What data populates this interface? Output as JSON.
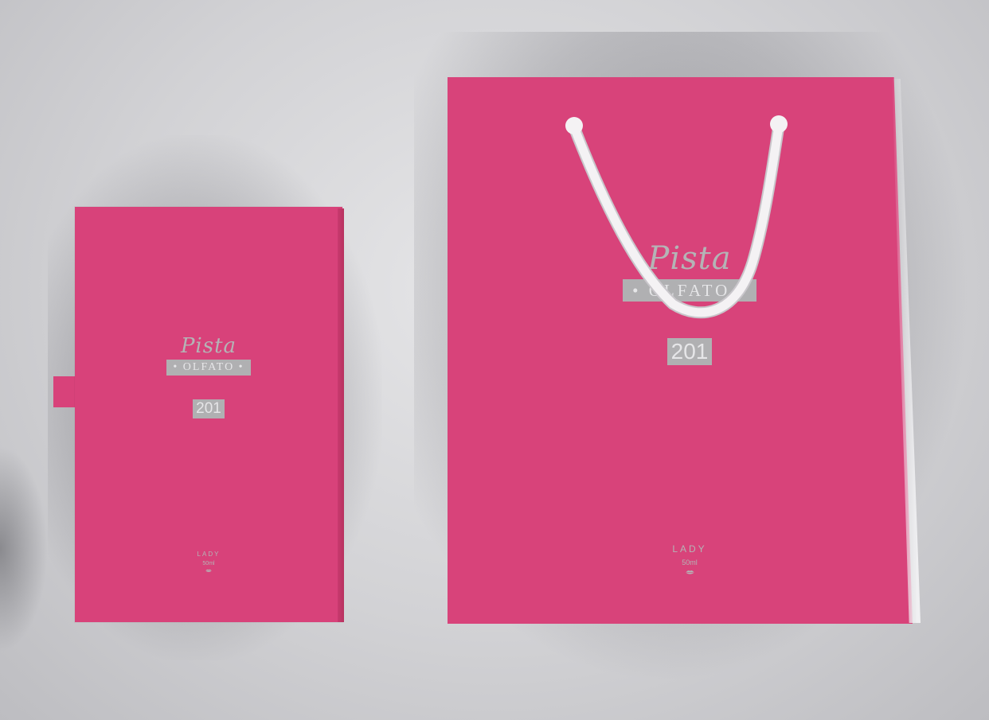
{
  "scene": {
    "background_color": "#d6d6d8",
    "package_color": "#d8427a",
    "print_color": "#b0b0b2",
    "rope_color": "#f4f2f4"
  },
  "box": {
    "script_text": "Pista",
    "band_text": "• OLFATO •",
    "number": "201",
    "variant": "LADY",
    "volume": "50ml",
    "icon": "lips-icon"
  },
  "bag": {
    "script_text": "Pista",
    "band_text": "• OLFATO •",
    "number": "201",
    "variant": "LADY",
    "volume": "50ml",
    "icon": "lips-icon"
  }
}
